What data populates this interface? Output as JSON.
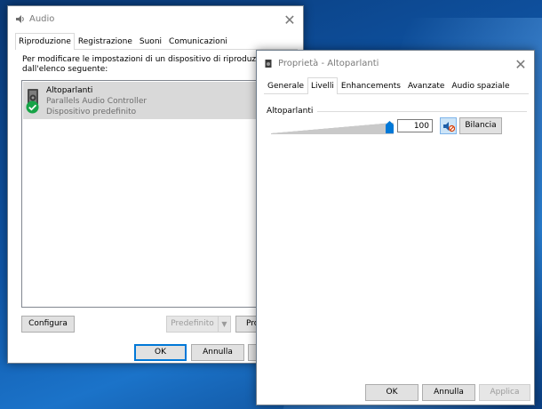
{
  "audio_window": {
    "title": "Audio",
    "tabs": [
      {
        "label": "Riproduzione",
        "active": true
      },
      {
        "label": "Registrazione",
        "active": false
      },
      {
        "label": "Suoni",
        "active": false
      },
      {
        "label": "Comunicazioni",
        "active": false
      }
    ],
    "instruction_line1": "Per modificare le impostazioni di un dispositivo di riproduzione, selezion",
    "instruction_line2": "dall'elenco seguente:",
    "device": {
      "name": "Altoparlanti",
      "controller": "Parallels Audio Controller",
      "status": "Dispositivo predefinito"
    },
    "configure_label": "Configura",
    "default_label": "Predefinito",
    "properties_label": "Pro",
    "ok_label": "OK",
    "cancel_label": "Annulla"
  },
  "properties_window": {
    "title": "Proprietà - Altoparlanti",
    "tabs": [
      {
        "label": "Generale",
        "active": false
      },
      {
        "label": "Livelli",
        "active": true
      },
      {
        "label": "Enhancements",
        "active": false
      },
      {
        "label": "Avanzate",
        "active": false
      },
      {
        "label": "Audio spaziale",
        "active": false
      }
    ],
    "group_label": "Altoparlanti",
    "level_value": "100",
    "level_fraction": 1.0,
    "balance_label": "Bilancia",
    "ok_label": "OK",
    "cancel_label": "Annulla",
    "apply_label": "Applica"
  },
  "colors": {
    "accent": "#0078d7",
    "selection": "#d9d9d9",
    "desktop": "#0f56a8",
    "check_green": "#17a347",
    "mute_red": "#d83b01"
  }
}
